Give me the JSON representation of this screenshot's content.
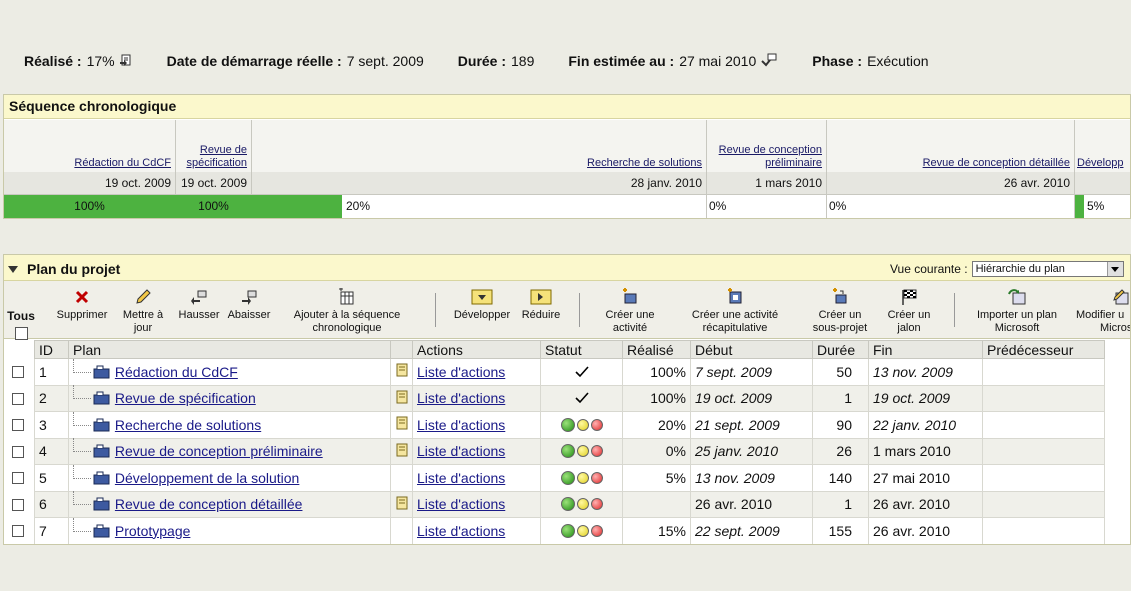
{
  "summary": {
    "realise_label": "Réalisé :",
    "realise_value": "17%",
    "date_label": "Date de démarrage réelle :",
    "date_value": "7 sept. 2009",
    "duree_label": "Durée :",
    "duree_value": "189",
    "fin_label": "Fin estimée au :",
    "fin_value": "27 mai 2010",
    "phase_label": "Phase :",
    "phase_value": "Exécution"
  },
  "timeline": {
    "title": "Séquence chronologique",
    "milestones": [
      {
        "label": "Rédaction du CdCF",
        "date": "19 oct. 2009",
        "progress_text": "100%",
        "progress": 100
      },
      {
        "label": "Revue de spécification",
        "date": "19 oct. 2009",
        "progress_text": "100%",
        "progress": 100
      },
      {
        "label": "Recherche de solutions",
        "date": "28 janv. 2010",
        "progress_text": "20%",
        "progress": 20
      },
      {
        "label": "Revue de conception préliminaire",
        "date": "1 mars 2010",
        "progress_text": "0%",
        "progress": 0
      },
      {
        "label": "Revue de conception détaillée",
        "date": "26 avr. 2010",
        "progress_text": "0%",
        "progress": 0
      },
      {
        "label": "Développ",
        "date": "",
        "progress_text": "5%",
        "progress": 5
      }
    ]
  },
  "plan": {
    "title": "Plan du projet",
    "vue_label": "Vue courante :",
    "vue_value": "Hiérarchie du plan",
    "tous_label": "Tous",
    "toolbar": {
      "supprimer": "Supprimer",
      "mettre_a_jour_1": "Mettre à",
      "mettre_a_jour_2": "jour",
      "hausser": "Hausser",
      "abaisser": "Abaisser",
      "ajouter_1": "Ajouter à la séquence",
      "ajouter_2": "chronologique",
      "developper": "Développer",
      "reduire": "Réduire",
      "creer_activite_1": "Créer une",
      "creer_activite_2": "activité",
      "creer_recap_1": "Créer une activité",
      "creer_recap_2": "récapitulative",
      "creer_sous_projet_1": "Créer un",
      "creer_sous_projet_2": "sous-projet",
      "creer_jalon_1": "Créer un",
      "creer_jalon_2": "jalon",
      "importer_1": "Importer un plan",
      "importer_2": "Microsoft",
      "modifier_1": "Modifier u",
      "modifier_2": "Micros"
    },
    "columns": {
      "id": "ID",
      "plan": "Plan",
      "actions": "Actions",
      "statut": "Statut",
      "realise": "Réalisé",
      "debut": "Début",
      "duree": "Durée",
      "fin": "Fin",
      "predecesseur": "Prédécesseur"
    },
    "rows": [
      {
        "id": "1",
        "name": "Rédaction du CdCF",
        "note": true,
        "actions": "Liste d'actions",
        "status": "check",
        "realise": "100%",
        "debut": "7 sept. 2009",
        "duree": "50",
        "fin": "13 nov. 2009"
      },
      {
        "id": "2",
        "name": "Revue de spécification",
        "note": true,
        "actions": "Liste d'actions",
        "status": "check",
        "realise": "100%",
        "debut": "19 oct. 2009",
        "duree": "1",
        "fin": "19 oct. 2009"
      },
      {
        "id": "3",
        "name": "Recherche de solutions",
        "note": true,
        "actions": "Liste d'actions",
        "status": "lights",
        "realise": "20%",
        "debut": "21 sept. 2009",
        "duree": "90",
        "fin": "22 janv. 2010"
      },
      {
        "id": "4",
        "name": "Revue de conception préliminaire",
        "note": true,
        "actions": "Liste d'actions",
        "status": "lights",
        "realise": "0%",
        "debut": "25 janv. 2010",
        "duree": "26",
        "fin": "1 mars 2010"
      },
      {
        "id": "5",
        "name": "Développement de la solution",
        "note": false,
        "actions": "Liste d'actions",
        "status": "lights",
        "realise": "5%",
        "debut": "13 nov. 2009",
        "duree": "140",
        "fin": "27 mai 2010"
      },
      {
        "id": "6",
        "name": "Revue de conception détaillée",
        "note": true,
        "actions": "Liste d'actions",
        "status": "lights",
        "realise": "",
        "debut": "26 avr. 2010",
        "duree": "1",
        "fin": "26 avr. 2010"
      },
      {
        "id": "7",
        "name": "Prototypage",
        "note": false,
        "actions": "Liste d'actions",
        "status": "lights",
        "realise": "15%",
        "debut": "22 sept. 2009",
        "duree": "155",
        "fin": "26 avr. 2010"
      }
    ]
  },
  "colors": {
    "accent_green": "#4db240",
    "header_yellow": "#fbf8cc",
    "link_blue": "#1a1a88"
  }
}
